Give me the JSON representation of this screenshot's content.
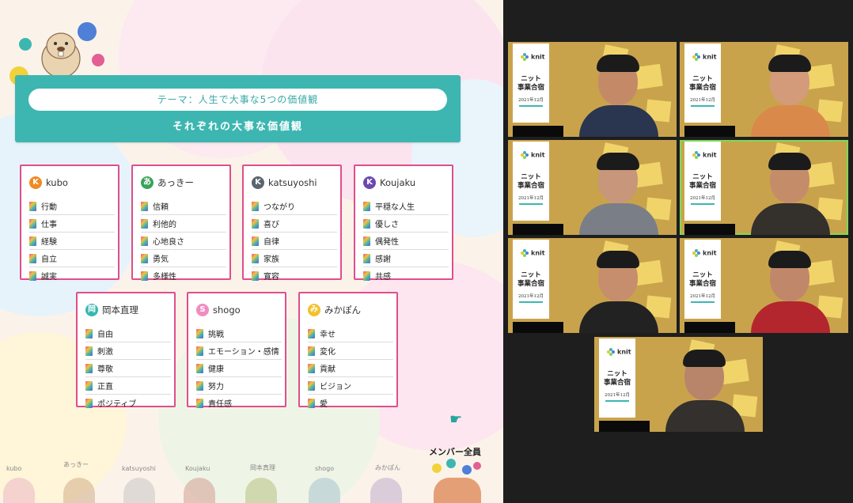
{
  "slide": {
    "theme_label": "テーマ：人生で大事な5つの価値観",
    "theme_title": "それぞれの大事な価値観",
    "accent_color": "#3db6b1",
    "card_border_color": "#e04e8a",
    "members_label": "メンバー全員",
    "pointer_icon": "pointing-hand-icon",
    "cards": [
      {
        "initial": "K",
        "name": "kubo",
        "color": "#f08a24",
        "values": [
          "行動",
          "仕事",
          "経験",
          "自立",
          "誠実"
        ]
      },
      {
        "initial": "あ",
        "name": "あっきー",
        "color": "#3aa35a",
        "values": [
          "信頼",
          "利他的",
          "心地良さ",
          "勇気",
          "多様性"
        ]
      },
      {
        "initial": "K",
        "name": "katsuyoshi",
        "color": "#5a6570",
        "values": [
          "つながり",
          "喜び",
          "自律",
          "家族",
          "寛容"
        ]
      },
      {
        "initial": "K",
        "name": "Koujaku",
        "color": "#6a4ab0",
        "values": [
          "平穏な人生",
          "優しさ",
          "偶発性",
          "感謝",
          "共感"
        ]
      },
      {
        "initial": "岡",
        "name": "岡本直理",
        "color": "#38b7b0",
        "values": [
          "自由",
          "刺激",
          "尊敬",
          "正直",
          "ポジティブ"
        ]
      },
      {
        "initial": "S",
        "name": "shogo",
        "color": "#ef8dc0",
        "values": [
          "挑戦",
          "エモーション・感情",
          "健康",
          "努力",
          "責任感"
        ]
      },
      {
        "initial": "み",
        "name": "みかぽん",
        "color": "#f2c12e",
        "values": [
          "幸せ",
          "変化",
          "貢献",
          "ビジョン",
          "愛"
        ]
      }
    ],
    "bottom_names": [
      "kubo",
      "あっきー",
      "katsuyoshi",
      "Koujaku",
      "岡本真理",
      "shogo",
      "みかぽん"
    ]
  },
  "video": {
    "poster_brand": "knit",
    "poster_title_line1": "ニット",
    "poster_title_line2": "事業合宿",
    "poster_date": "2021年12月",
    "participants": 7,
    "active_speaker_index": 3
  }
}
